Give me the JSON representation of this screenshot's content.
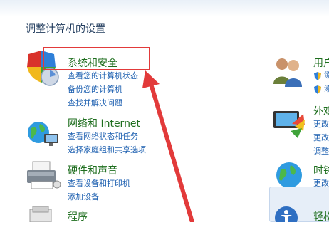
{
  "page": {
    "title": "调整计算机的设置"
  },
  "categories": [
    {
      "title": "系统和安全",
      "icon": "shield-icon",
      "links": [
        "查看您的计算机状态",
        "备份您的计算机",
        "查找并解决问题"
      ]
    },
    {
      "title": "网络和 Internet",
      "icon": "network-globe-icon",
      "links": [
        "查看网络状态和任务",
        "选择家庭组和共享选项"
      ]
    },
    {
      "title": "硬件和声音",
      "icon": "printer-icon",
      "links": [
        "查看设备和打印机",
        "添加设备"
      ]
    },
    {
      "title": "程序",
      "icon": "programs-icon",
      "links": []
    }
  ],
  "right_column": [
    {
      "title": "用户",
      "icon": "users-icon",
      "links": [
        "添",
        "添"
      ]
    },
    {
      "title": "外观",
      "icon": "appearance-icon",
      "links": [
        "更改",
        "更改",
        "调整"
      ]
    },
    {
      "title": "时钟",
      "icon": "clock-globe-icon",
      "links": [
        "更改",
        "更改"
      ]
    },
    {
      "title": "轻松",
      "icon": "ease-of-access-icon",
      "links": []
    }
  ],
  "annotations": {
    "highlight_color": "#e23a3a",
    "arrow_color": "#e23a3a"
  }
}
